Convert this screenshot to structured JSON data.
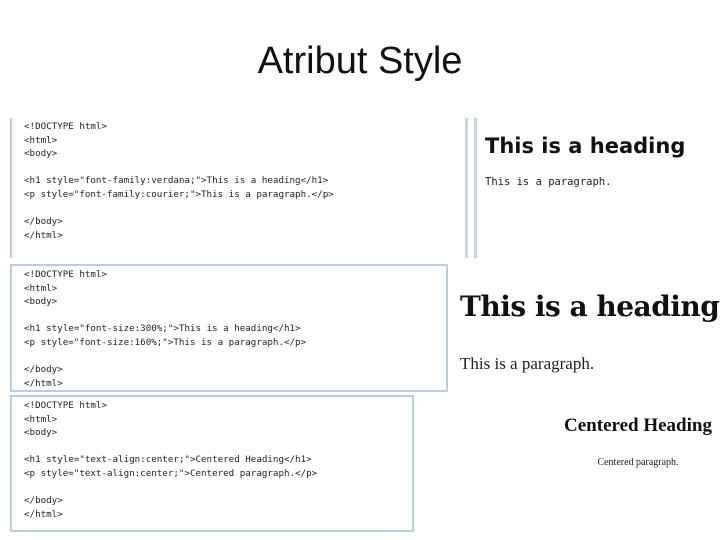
{
  "slide": {
    "title": "Atribut Style"
  },
  "examples": [
    {
      "code": [
        "<!DOCTYPE html>",
        "<html>",
        "<body>",
        "",
        "<h1 style=\"font-family:verdana;\">This is a heading</h1>",
        "<p style=\"font-family:courier;\">This is a paragraph.</p>",
        "",
        "</body>",
        "</html>"
      ],
      "output_heading": "This is a heading",
      "output_paragraph": "This is a paragraph."
    },
    {
      "code": [
        "<!DOCTYPE html>",
        "<html>",
        "<body>",
        "",
        "<h1 style=\"font-size:300%;\">This is a heading</h1>",
        "<p style=\"font-size:160%;\">This is a paragraph.</p>",
        "",
        "</body>",
        "</html>"
      ],
      "output_heading": "This is a heading",
      "output_paragraph": "This is a paragraph."
    },
    {
      "code": [
        "<!DOCTYPE html>",
        "<html>",
        "<body>",
        "",
        "<h1 style=\"text-align:center;\">Centered Heading</h1>",
        "<p style=\"text-align:center;\">Centered paragraph.</p>",
        "",
        "</body>",
        "</html>"
      ],
      "output_heading": "Centered Heading",
      "output_paragraph": "Centered paragraph."
    }
  ]
}
